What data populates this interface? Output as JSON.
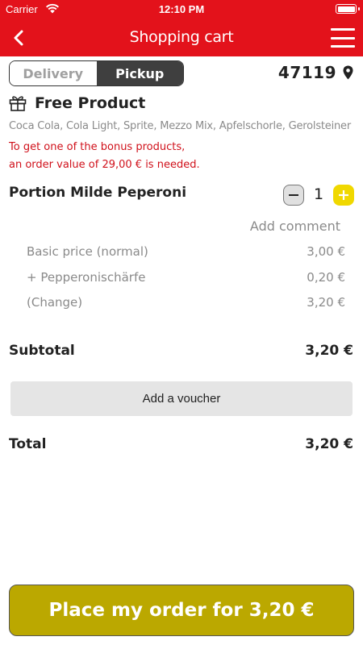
{
  "status_bar": {
    "carrier": "Carrier",
    "time": "12:10 PM"
  },
  "nav": {
    "title": "Shopping cart"
  },
  "mode": {
    "delivery_label": "Delivery",
    "pickup_label": "Pickup",
    "selected": "Pickup"
  },
  "store": {
    "number": "47119"
  },
  "free_product": {
    "title": "Free Product",
    "options": "Coca Cola, Cola Light, Sprite, Mezzo Mix, Apfelschorle, Gerolsteiner",
    "note_line1": "To get one of the bonus products,",
    "note_line2": "an order value of 29,00 € is needed."
  },
  "item": {
    "name": "Portion Milde Peperoni",
    "quantity": "1",
    "add_comment": "Add comment",
    "prices": [
      {
        "label": "Basic price (normal)",
        "value": "3,00 €"
      },
      {
        "label": "+ Pepperonischärfe",
        "value": "0,20 €"
      },
      {
        "label": "(Change)",
        "value": "3,20 €"
      }
    ]
  },
  "summary": {
    "subtotal_label": "Subtotal",
    "subtotal_value": "3,20 €",
    "voucher_label": "Add a voucher",
    "total_label": "Total",
    "total_value": "3,20 €"
  },
  "order_button": {
    "label": "Place my order for 3,20 €"
  },
  "colors": {
    "header": "#e3121b",
    "accent_yellow": "#f0d800",
    "order_button": "#bba800",
    "warning_text": "#d0101a"
  }
}
